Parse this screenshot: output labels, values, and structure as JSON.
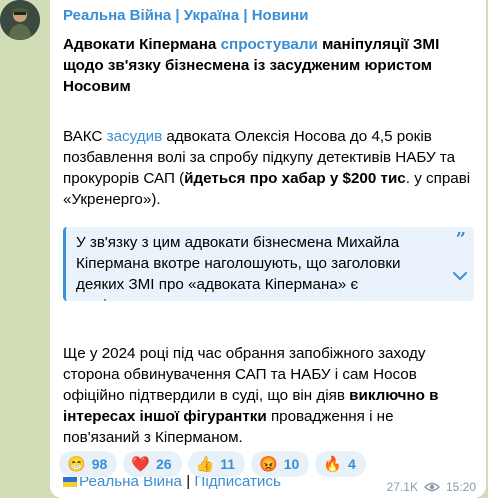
{
  "channel": {
    "name": "Реальна Війна | Україна | Новини"
  },
  "post": {
    "headline_a": "Адвокати Кіпермана ",
    "headline_link": "спростували",
    "headline_b": " маніпуляції ЗМІ щодо зв'язку бізнесмена із засудженим юристом Носовим",
    "p1_a": "ВАКС ",
    "p1_link": "засудив",
    "p1_b": " адвоката Олексія Носова до 4,5 років позбавлення волі за спробу підкупу детективів НАБУ та прокурорів САП (",
    "p1_bold": "йдеться про хабар у $200 тис",
    "p1_c": ". у справі «Укренерго»).",
    "quote": "У зв'язку з цим адвокати бізнесмена Михайла Кіпермана вкотре наголошують, що заголовки деяких ЗМІ про «адвоката Кіпермана» є маніпулятивними та...",
    "p2_a": "Ще у 2024 році під час обрання запобіжного заходу сторона обвинувачення САП та НАБУ і сам Носов офіційно підтвердили в суді, що він діяв ",
    "p2_bold": "виключно в інтересах іншої фігурантки",
    "p2_b": " провадження і не пов'язаний з Кіперманом.",
    "link_channel": "Реальна Війна",
    "link_sep": " | ",
    "link_subscribe": "Підписатись"
  },
  "reactions": [
    {
      "emoji": "😁",
      "icon": "grin-emoji-icon",
      "count": "98"
    },
    {
      "emoji": "❤️",
      "icon": "heart-emoji-icon",
      "count": "26"
    },
    {
      "emoji": "👍",
      "icon": "thumbs-up-emoji-icon",
      "count": "11"
    },
    {
      "emoji": "😡",
      "icon": "angry-emoji-icon",
      "count": "10"
    },
    {
      "emoji": "🔥",
      "icon": "fire-emoji-icon",
      "count": "4"
    }
  ],
  "meta": {
    "views": "27.1K",
    "time": "15:20"
  },
  "colors": {
    "accent": "#3a8ed3",
    "quote_bg": "#eaf3fb",
    "background": "#cfdcb6"
  }
}
